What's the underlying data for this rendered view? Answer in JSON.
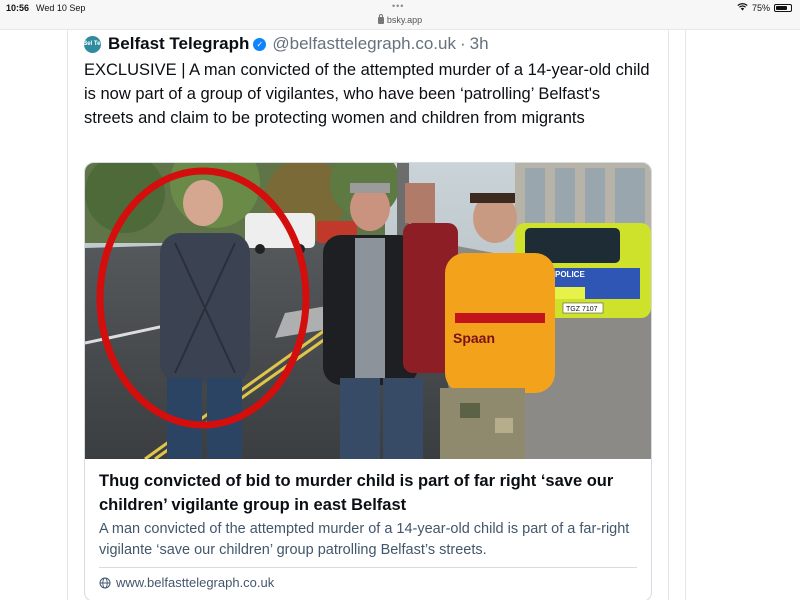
{
  "status_bar": {
    "time": "10:56",
    "date": "Wed 10 Sep",
    "dots": "•••",
    "url": "bsky.app",
    "battery_percent": "75%",
    "battery_level": 0.75
  },
  "post": {
    "avatar_text": "Bel Tel",
    "display_name": "Belfast Telegraph",
    "handle": "@belfasttelegraph.co.uk",
    "separator": "·",
    "timestamp": "3h",
    "text": "EXCLUSIVE | A man convicted of the attempted murder of a 14-year-old child is now part of a group of vigilantes, who have been ‘patrolling’ Belfast's streets and claim to be protecting women and children from migrants"
  },
  "card": {
    "title": "Thug convicted of bid to murder child is part of far right ‘save our children’ vigilante group in east Belfast",
    "description": "A man convicted of the attempted murder of a 14-year-old child is part of a far-right vigilante ‘save our children’ group patrolling Belfast’s streets.",
    "domain": "www.belfasttelegraph.co.uk",
    "image": {
      "police_text": "POLICE",
      "plate_text": "TGZ 7107",
      "shirt_text": "Spaan"
    }
  },
  "colors": {
    "accent_blue": "#1083fe",
    "muted_text": "#66717d",
    "card_border": "#d4dbe2",
    "highlight_red": "#d40d0d"
  },
  "icons": [
    "lock-icon",
    "wifi-icon",
    "battery-icon",
    "verified-icon",
    "globe-icon"
  ]
}
